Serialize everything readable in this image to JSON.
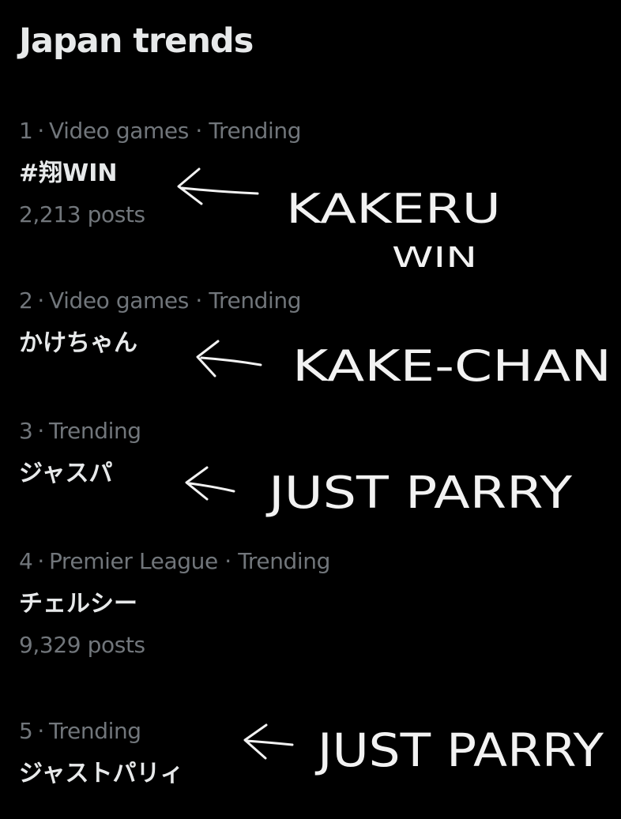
{
  "page": {
    "title": "Japan trends"
  },
  "trends": [
    {
      "rank": "1",
      "rank_separator": "·",
      "context": "Video games · Trending",
      "name": "#翔WIN",
      "posts": "2,213 posts"
    },
    {
      "rank": "2",
      "rank_separator": "·",
      "context": "Video games · Trending",
      "name": "かけちゃん",
      "posts": ""
    },
    {
      "rank": "3",
      "rank_separator": "·",
      "context": "Trending",
      "name": "ジャスパ",
      "posts": ""
    },
    {
      "rank": "4",
      "rank_separator": "·",
      "context": "Premier League · Trending",
      "name": "チェルシー",
      "posts": "9,329 posts"
    },
    {
      "rank": "5",
      "rank_separator": "·",
      "context": "Trending",
      "name": "ジャストパリィ",
      "posts": ""
    }
  ],
  "annotations": [
    {
      "icon": "left-arrow-icon",
      "text": "KAKERU",
      "subtext": "WIN"
    },
    {
      "icon": "left-arrow-icon",
      "text": "KAKE-CHAN"
    },
    {
      "icon": "left-arrow-icon",
      "text": "JUST PARRY"
    },
    {
      "icon": "left-arrow-icon",
      "text": "JUST PARRY"
    }
  ],
  "colors": {
    "background": "#000000",
    "primary_text": "#e7e9ea",
    "secondary_text": "#71767b",
    "annotation_ink": "#f2f2f2"
  }
}
